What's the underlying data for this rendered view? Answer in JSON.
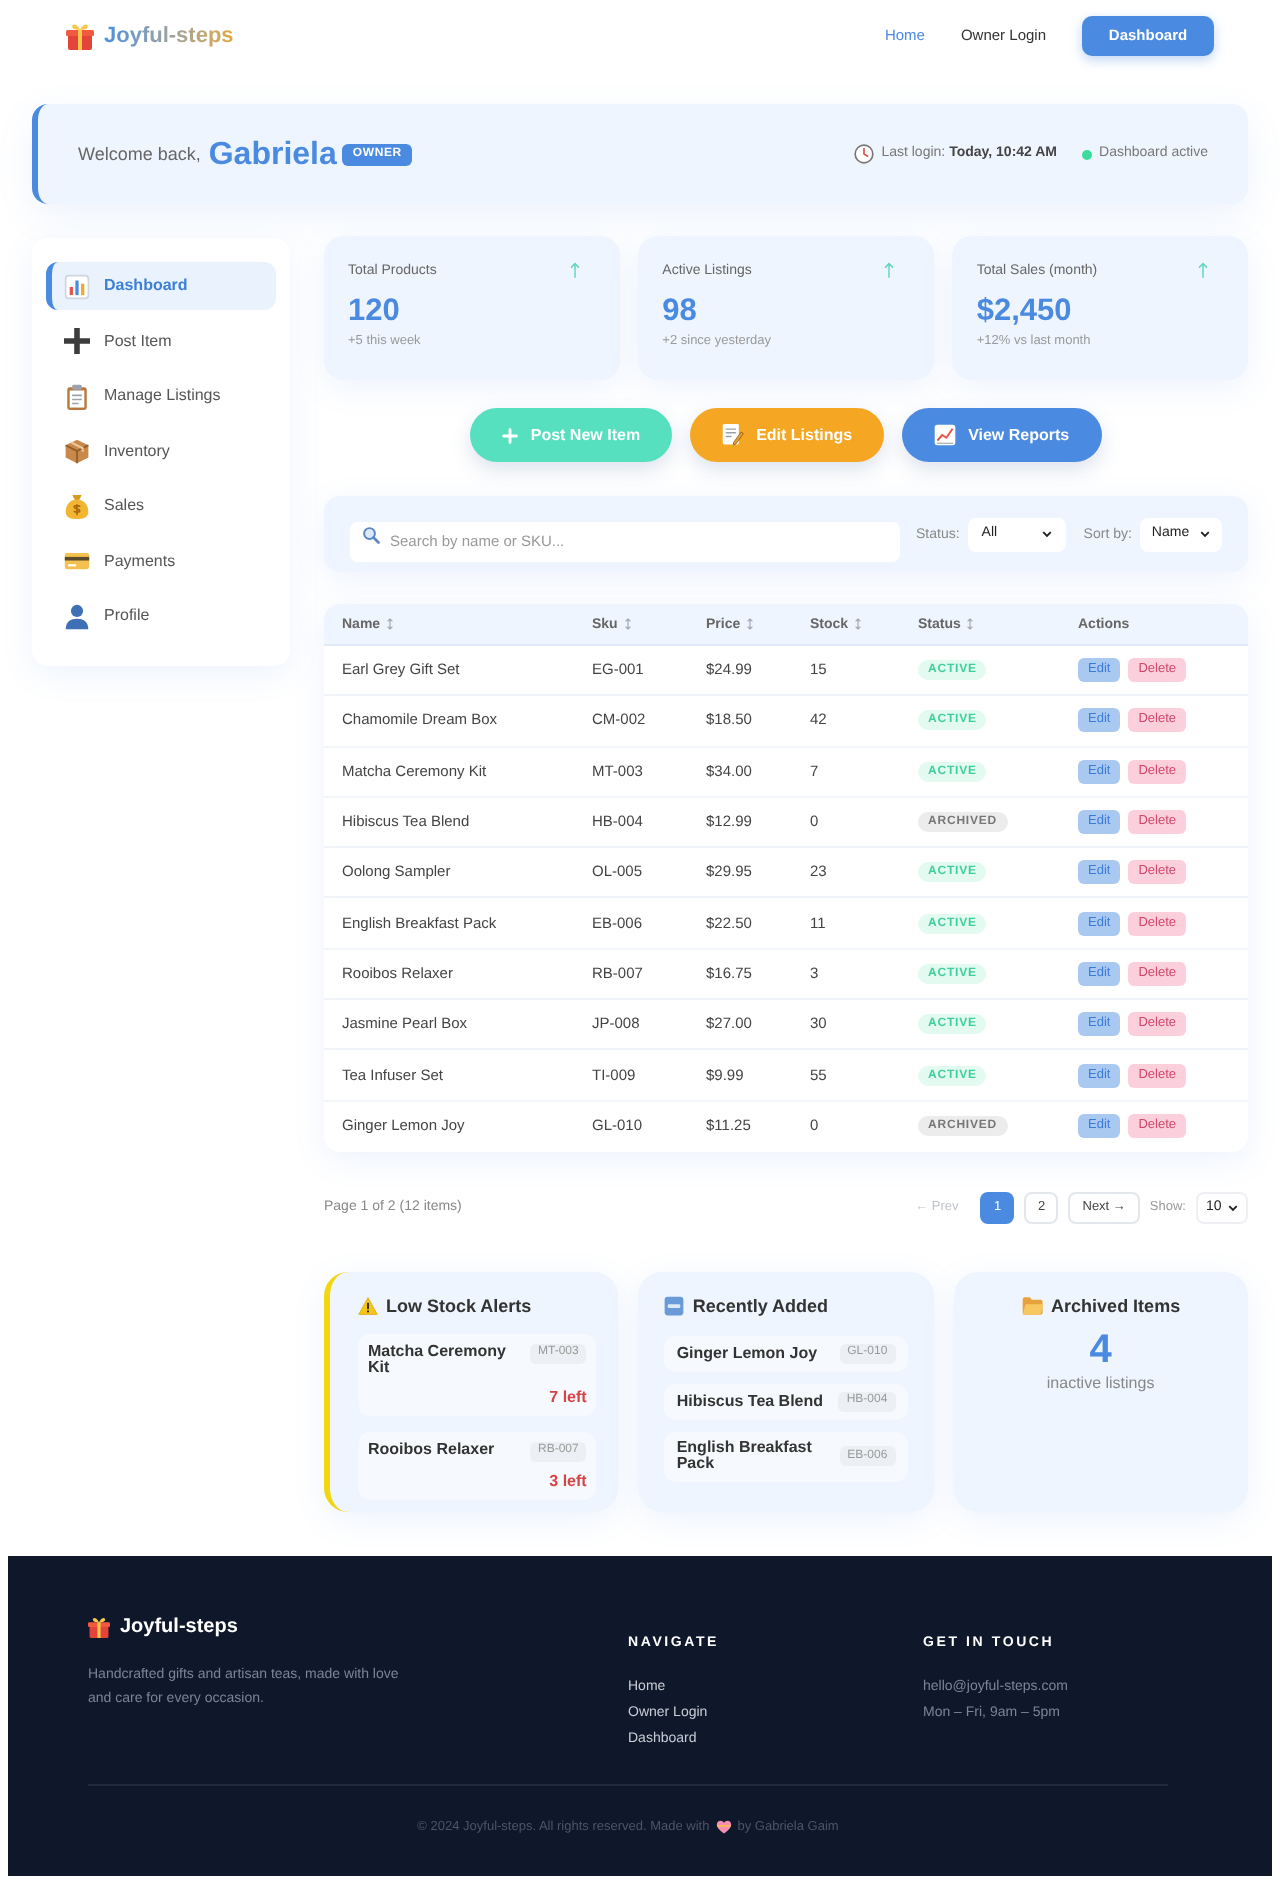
{
  "header": {
    "logo": "Joyful-steps",
    "nav": [
      {
        "label": "Home",
        "kind": "link",
        "selected": true
      },
      {
        "label": "Owner Login",
        "kind": "link",
        "selected": false
      },
      {
        "label": "Dashboard",
        "kind": "button",
        "selected": false
      }
    ]
  },
  "welcome": {
    "greeting": "Welcome back,",
    "name": "Gabriela",
    "badge": "OWNER",
    "last_login": "Last login: **Today, 10:42 AM**",
    "status": "Dashboard active"
  },
  "sidebar": {
    "items": [
      {
        "label": "Dashboard",
        "selected": true
      },
      {
        "label": "Post Item",
        "selected": false
      },
      {
        "label": "Manage Listings",
        "selected": false
      },
      {
        "label": "Inventory",
        "selected": false
      },
      {
        "label": "Sales",
        "selected": false
      },
      {
        "label": "Payments",
        "selected": false
      },
      {
        "label": "Profile",
        "selected": false
      }
    ]
  },
  "stats": [
    {
      "label": "Total Products",
      "value": "120",
      "note": "+5 this week"
    },
    {
      "label": "Active Listings",
      "value": "98",
      "note": "+2 since yesterday"
    },
    {
      "label": "Total Sales (month)",
      "value": "$2,450",
      "note": "+12% vs last month"
    }
  ],
  "actions": [
    {
      "label": "Post New Item",
      "color": "#56e0c0"
    },
    {
      "label": "Edit Listings",
      "color": "#f5a623"
    },
    {
      "label": "View Reports",
      "color": "#4a8ae0"
    }
  ],
  "filters": {
    "search": {
      "placeholder": "Search by name or SKU..."
    },
    "status": {
      "label": "Status:",
      "value": "All"
    },
    "sort": {
      "label": "Sort by:",
      "value": "Name"
    }
  },
  "table": {
    "columns": [
      {
        "label": "Name",
        "sortable": true
      },
      {
        "label": "Sku",
        "sortable": true
      },
      {
        "label": "Price",
        "sortable": true
      },
      {
        "label": "Stock",
        "sortable": true
      },
      {
        "label": "Status",
        "sortable": true
      },
      {
        "label": "Actions",
        "sortable": false
      }
    ],
    "rows": [
      {
        "name": "Earl Grey Gift Set",
        "sku": "EG-001",
        "price": "$24.99",
        "stock": "15",
        "status": {
          "label": "ACTIVE",
          "kind": "active"
        },
        "actions": [
          "Edit",
          "Delete"
        ]
      },
      {
        "name": "Chamomile Dream Box",
        "sku": "CM-002",
        "price": "$18.50",
        "stock": "42",
        "status": {
          "label": "ACTIVE",
          "kind": "active"
        },
        "actions": [
          "Edit",
          "Delete"
        ]
      },
      {
        "name": "Matcha Ceremony Kit",
        "sku": "MT-003",
        "price": "$34.00",
        "stock": "7",
        "status": {
          "label": "ACTIVE",
          "kind": "active"
        },
        "actions": [
          "Edit",
          "Delete"
        ]
      },
      {
        "name": "Hibiscus Tea Blend",
        "sku": "HB-004",
        "price": "$12.99",
        "stock": "0",
        "status": {
          "label": "ARCHIVED",
          "kind": "archived"
        },
        "actions": [
          "Edit",
          "Delete"
        ]
      },
      {
        "name": "Oolong Sampler",
        "sku": "OL-005",
        "price": "$29.95",
        "stock": "23",
        "status": {
          "label": "ACTIVE",
          "kind": "active"
        },
        "actions": [
          "Edit",
          "Delete"
        ]
      },
      {
        "name": "English Breakfast Pack",
        "sku": "EB-006",
        "price": "$22.50",
        "stock": "11",
        "status": {
          "label": "ACTIVE",
          "kind": "active"
        },
        "actions": [
          "Edit",
          "Delete"
        ]
      },
      {
        "name": "Rooibos Relaxer",
        "sku": "RB-007",
        "price": "$16.75",
        "stock": "3",
        "status": {
          "label": "ACTIVE",
          "kind": "active"
        },
        "actions": [
          "Edit",
          "Delete"
        ]
      },
      {
        "name": "Jasmine Pearl Box",
        "sku": "JP-008",
        "price": "$27.00",
        "stock": "30",
        "status": {
          "label": "ACTIVE",
          "kind": "active"
        },
        "actions": [
          "Edit",
          "Delete"
        ]
      },
      {
        "name": "Tea Infuser Set",
        "sku": "TI-009",
        "price": "$9.99",
        "stock": "55",
        "status": {
          "label": "ACTIVE",
          "kind": "active"
        },
        "actions": [
          "Edit",
          "Delete"
        ]
      },
      {
        "name": "Ginger Lemon Joy",
        "sku": "GL-010",
        "price": "$11.25",
        "stock": "0",
        "status": {
          "label": "ARCHIVED",
          "kind": "archived"
        },
        "actions": [
          "Edit",
          "Delete"
        ]
      }
    ]
  },
  "pagination": {
    "summary": "Page 1 of 2 (12 items)",
    "prev": {
      "label": "← Prev",
      "disabled": true
    },
    "pages": [
      {
        "label": "1",
        "selected": true
      },
      {
        "label": "2",
        "selected": false
      }
    ],
    "next": {
      "label": "Next →",
      "disabled": false
    },
    "show_label": "Show:",
    "page_size": "10"
  },
  "panels": [
    {
      "kind": "alerts",
      "title": "Low Stock Alerts",
      "items": [
        {
          "name": "Matcha Ceremony Kit",
          "sku": "MT-003",
          "note": "7 left"
        },
        {
          "name": "Rooibos Relaxer",
          "sku": "RB-007",
          "note": "3 left"
        }
      ]
    },
    {
      "kind": "recent",
      "title": "Recently Added",
      "items": [
        {
          "name": "Ginger Lemon Joy",
          "sku": "GL-010"
        },
        {
          "name": "Hibiscus Tea Blend",
          "sku": "HB-004"
        },
        {
          "name": "English Breakfast Pack",
          "sku": "EB-006"
        }
      ]
    },
    {
      "kind": "summary",
      "title": "Archived Items",
      "count": "4",
      "caption": "inactive listings"
    }
  ],
  "footer": {
    "brand": "Joyful-steps",
    "tagline": "Handcrafted gifts and artisan teas, made with love and care for every occasion.",
    "columns": [
      {
        "kind": "links",
        "heading": "NAVIGATE",
        "items": [
          "Home",
          "Owner Login",
          "Dashboard"
        ]
      },
      {
        "kind": "contact",
        "heading": "GET IN TOUCH",
        "items": [
          "hello@joyful-steps.com",
          "Mon – Fri, 9am – 5pm"
        ]
      }
    ],
    "copyright_before": "© 2024 Joyful-steps. All rights reserved. Made with",
    "copyright_after": "by Gabriela Gaim"
  }
}
